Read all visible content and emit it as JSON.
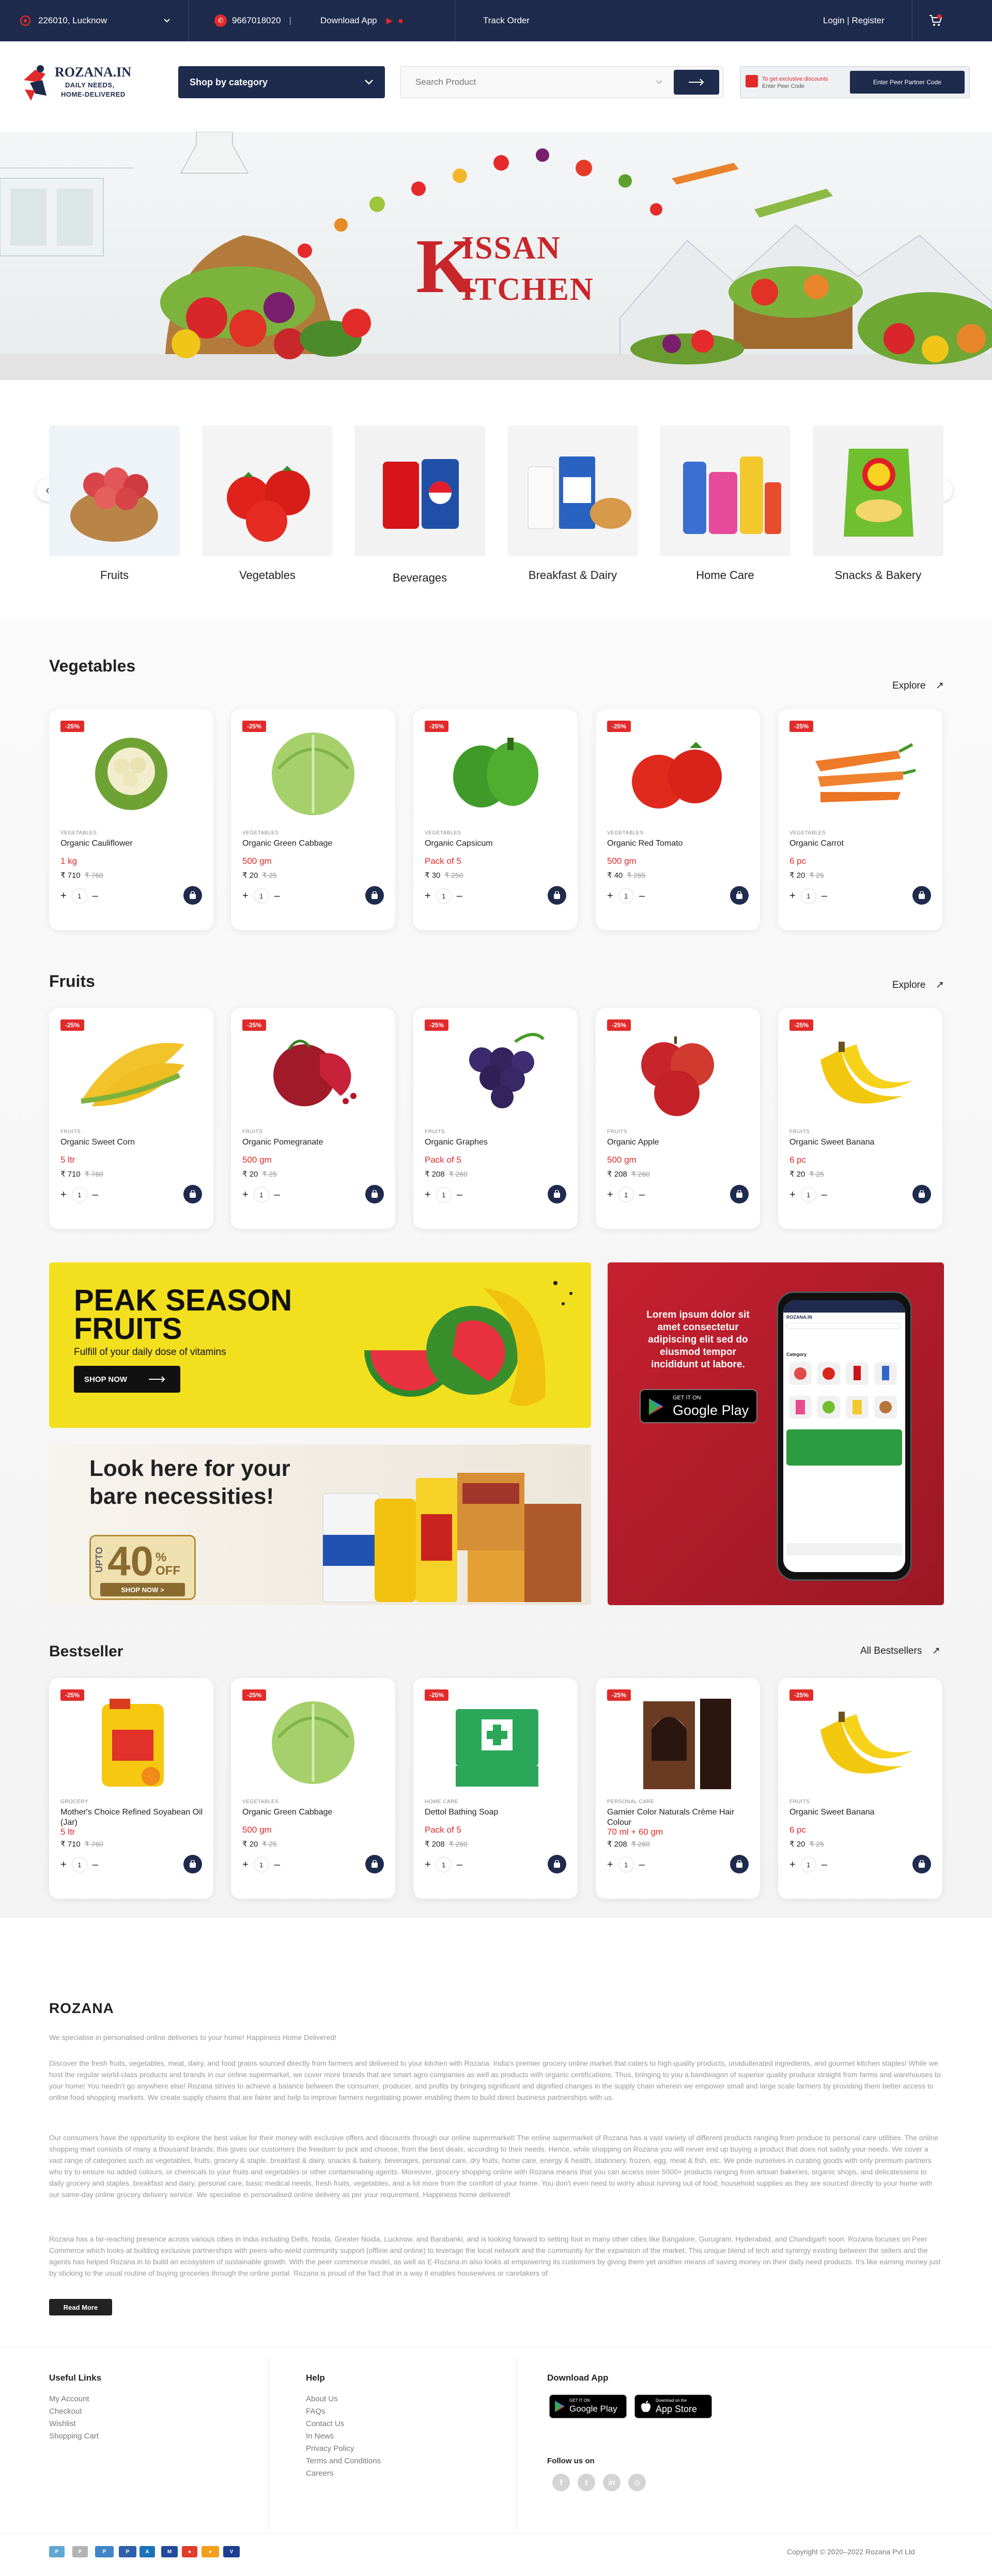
{
  "topbar": {
    "location": "226010, Lucknow",
    "phone": "9667018020",
    "download_app": "Download App",
    "track_order": "Track Order",
    "login": "Login | Register"
  },
  "header": {
    "logo_title": "ROZANA.IN",
    "logo_tagline1": "DAILY NEEDS,",
    "logo_tagline2": "HOME-DELIVERED",
    "category_button": "Shop by category",
    "search_placeholder": "Search Product",
    "partner_line1": "To get exclusive discounts",
    "partner_line2": "Enter Peer Code",
    "partner_button": "Enter Peer Partner Code"
  },
  "hero": {
    "title_k": "K",
    "title_rest1": "ISSAN",
    "title_rest2": "ITCHEN"
  },
  "categories": [
    {
      "label": "Fruits"
    },
    {
      "label": "Vegetables"
    },
    {
      "label": "Beverages"
    },
    {
      "label": "Breakfast & Dairy"
    },
    {
      "label": "Home Care"
    },
    {
      "label": "Snacks & Bakery"
    }
  ],
  "vegetables": {
    "title": "Vegetables",
    "explore": "Explore",
    "products": [
      {
        "discount": "-25%",
        "type": "VEGETABLES",
        "name": "Organic Cauliflower",
        "qty": "1 kg",
        "price": "₹ 710",
        "mrp": "₹ 760"
      },
      {
        "discount": "-25%",
        "type": "VEGETABLES",
        "name": "Organic Green Cabbage",
        "qty": "500 gm",
        "price": "₹ 20",
        "mrp": "₹ 25"
      },
      {
        "discount": "-25%",
        "type": "VEGETABLES",
        "name": "Organic Capsicum",
        "qty": "Pack of 5",
        "price": "₹ 30",
        "mrp": "₹ 250"
      },
      {
        "discount": "-25%",
        "type": "VEGETABLES",
        "name": "Organic Red Tomato",
        "qty": "500 gm",
        "price": "₹ 40",
        "mrp": "₹ 265"
      },
      {
        "discount": "-25%",
        "type": "VEGETABLES",
        "name": "Organic Carrot",
        "qty": "6 pc",
        "price": "₹ 20",
        "mrp": "₹ 25"
      }
    ]
  },
  "fruits": {
    "title": "Fruits",
    "explore": "Explore",
    "products": [
      {
        "discount": "-25%",
        "type": "FRUITS",
        "name": "Organic Sweet Corn",
        "qty": "5 ltr",
        "price": "₹ 710",
        "mrp": "₹ 760"
      },
      {
        "discount": "-25%",
        "type": "FRUITS",
        "name": "Organic Pomegranate",
        "qty": "500 gm",
        "price": "₹ 20",
        "mrp": "₹ 25"
      },
      {
        "discount": "-25%",
        "type": "FRUITS",
        "name": "Organic Graphes",
        "qty": "Pack of 5",
        "price": "₹ 208",
        "mrp": "₹ 260"
      },
      {
        "discount": "-25%",
        "type": "FRUITS",
        "name": "Organic Apple",
        "qty": "500 gm",
        "price": "₹ 208",
        "mrp": "₹ 260"
      },
      {
        "discount": "-25%",
        "type": "FRUITS",
        "name": "Organic Sweet Banana",
        "qty": "6 pc",
        "price": "₹ 20",
        "mrp": "₹ 25"
      }
    ]
  },
  "promo": {
    "peak_title1": "PEAK SEASON",
    "peak_title2": "FRUITS",
    "peak_sub": "Fulfill of your daily dose of vitamins",
    "peak_btn": "SHOP NOW",
    "app_text": "Lorem ipsum dolor sit amet consectetur adipiscing elit sed do eiusmod tempor incididunt ut labore.",
    "gp_small": "GET IT ON",
    "gp_big": "Google Play",
    "bare_title1": "Look here for your",
    "bare_title2": "bare necessities!",
    "upto": "UPTO",
    "off_pct": "40",
    "off_suffix": "% OFF",
    "shop_now": "SHOP NOW >",
    "phone_logo": "ROZANA.IN",
    "phone_category": "Category"
  },
  "bestseller": {
    "title": "Bestseller",
    "all": "All Bestsellers",
    "products": [
      {
        "discount": "-25%",
        "type": "GROCERY",
        "name": "Mother's Choice Refined Soyabean Oil (Jar)",
        "qty": "5 ltr",
        "price": "₹ 710",
        "mrp": "₹ 760"
      },
      {
        "discount": "-25%",
        "type": "VEGETABLES",
        "name": "Organic Green Cabbage",
        "qty": "500 gm",
        "price": "₹ 20",
        "mrp": "₹ 25"
      },
      {
        "discount": "-25%",
        "type": "HOME CARE",
        "name": "Dettol Bathing Soap",
        "qty": "Pack of 5",
        "price": "₹ 208",
        "mrp": "₹ 260"
      },
      {
        "discount": "-25%",
        "type": "PERSONAL CARE",
        "name": "Garnier Color Naturals Crème Hair Colour",
        "qty": "70 ml + 60 gm",
        "price": "₹ 208",
        "mrp": "₹ 260"
      },
      {
        "discount": "-25%",
        "type": "FRUITS",
        "name": "Organic Sweet Banana",
        "qty": "6 pc",
        "price": "₹ 20",
        "mrp": "₹ 25"
      }
    ]
  },
  "about": {
    "title": "ROZANA",
    "intro": "We specialise in personalised online deliveries to your home! Happiness Home Delivered!",
    "p1": "Discover the fresh fruits, vegetables, meat, dairy, and food grains sourced directly from farmers and delivered to your kitchen with Rozana: India's premier grocery online market that caters to high-quality products, unadulterated ingredients, and gourmet kitchen staples! While we host the regular world-class products and brands in our online supermarket, we cover more brands that are smart agro companies as well as products with organic certifications. Thus, bringing to you a bandwagon of superior quality produce straight from farms and warehouses to your home! You needn't go anywhere else! Rozana strives to achieve a balance between the consumer, producer, and profits by bringing significant and dignified changes in the supply chain wherein we empower small and large scale farmers by providing them better access to online food shopping markets. We create supply chains that are fairer and help to improve farmers negotiating power enabling them to build direct business partnerships with us.",
    "p2": "Our consumers have the opportunity to explore the best value for their money with exclusive offers and discounts through our online supermarket! The online supermarket of Rozana has a vast variety of different products ranging from produce to personal care utilities. The online shopping mart consists of many a thousand brands; this gives our customers the freedom to pick and choose, from the best deals, according to their needs. Hence, while shopping on Rozana you will never end up buying a product that does not satisfy your needs. We cover a vast range of categories such as vegetables, fruits, grocery & staple, breakfast & dairy, snacks & bakery, beverages, personal care, dry fruits, home care, energy & health, stationery, frozen, egg, meat & fish, etc. We pride ourselves in curating goods with only premium partners who try to ensure no added colours, or chemicals to your fruits and vegetables or other contaminating agents. Moreover, grocery shopping online with Rozana means that you can access over 5000+ products ranging from artisan bakeries, organic shops, and delicatessens to daily grocery and staples, breakfast and dairy, personal care, basic medical needs, fresh fruits, vegetables, and a lot more from the comfort of your home. You don't even need to worry about running out of food; household supplies as they are sourced directly to your home with our same-day online grocery delivery service. We specialise in personalised online delivery as per your requirement. Happiness home delivered!",
    "p3": "Rozana has a far-reaching presence across various cities in India including Delhi, Noida, Greater Noida, Lucknow, and Barabanki, and is looking forward to setting foot in many other cities like Bangalore, Gurugram, Hyderabad, and Chandigarh soon. Rozana focuses on Peer Commerce which looks at building exclusive partnerships with peers who wield community support (offline and online) to leverage the local network and the community for the expansion of the market. This unique blend of tech and synergy existing between the sellers and the agents has helped Rozana.in to build an ecosystem of sustainable growth. With the peer commerce model, as well as E-Rozana.in also looks at empowering its customers by giving them yet another means of saving money on their daily need products. It's like earning money just by sticking to the usual routine of buying groceries through the online portal. Rozana is proud of the fact that in a way it enables housewives or caretakers of",
    "read_more": "Read More"
  },
  "footer": {
    "useful_title": "Useful Links",
    "useful": [
      "My Account",
      "Checkout",
      "Wishlist",
      "Shopping Cart"
    ],
    "help_title": "Help",
    "help": [
      "About Us",
      "FAQs",
      "Contact Us",
      "In News",
      "Privacy Policy",
      "Terms and Conditions",
      "Careers"
    ],
    "download_title": "Download App",
    "gp_small": "GET IT ON",
    "gp_big": "Google Play",
    "as_small": "Download on the",
    "as_big": "App Store",
    "follow_title": "Follow us on",
    "copyright": "Copyright © 2020–2022 Rozana Pvt Ltd"
  },
  "colors": {
    "navy": "#1e2b4d",
    "accent_red": "#e12a2a",
    "promo_yellow": "#f2e01f",
    "promo_red": "#b51d2b"
  }
}
